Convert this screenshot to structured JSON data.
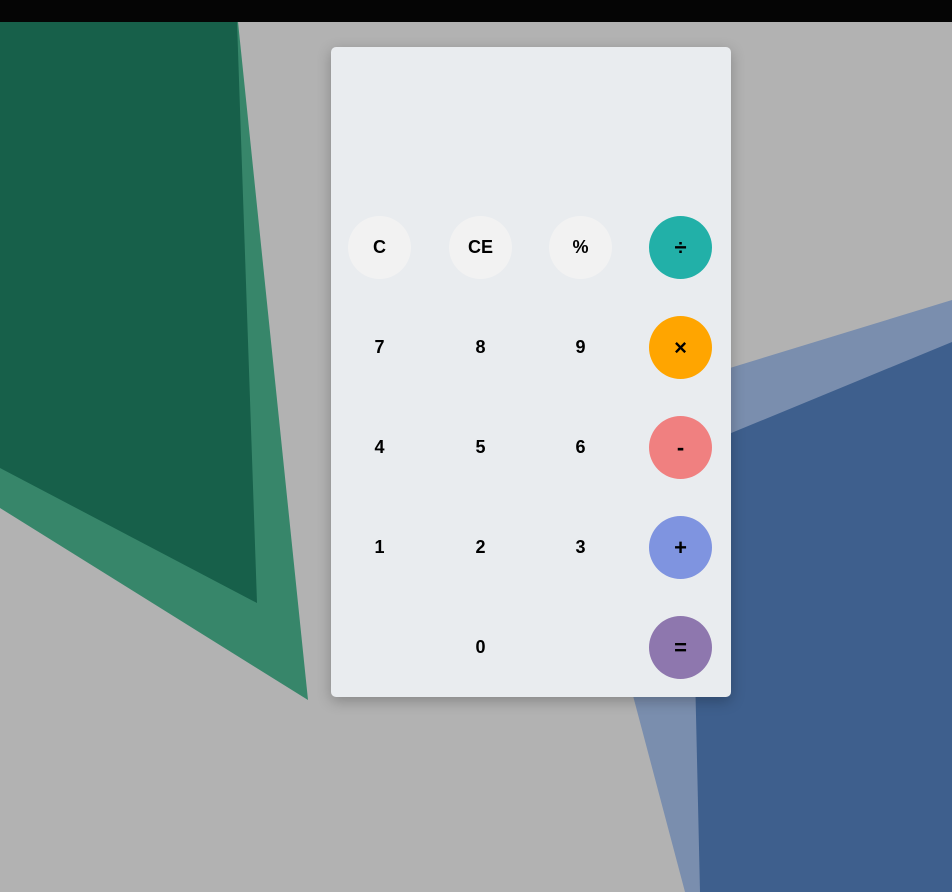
{
  "display": {
    "value": ""
  },
  "keys": {
    "clear": "C",
    "clear_entry": "CE",
    "percent": "%",
    "divide": "÷",
    "seven": "7",
    "eight": "8",
    "nine": "9",
    "multiply": "×",
    "four": "4",
    "five": "5",
    "six": "6",
    "subtract": "-",
    "one": "1",
    "two": "2",
    "three": "3",
    "add": "+",
    "zero": "0",
    "equals": "="
  },
  "colors": {
    "divide": "#22b0a8",
    "multiply": "#ffa500",
    "subtract": "#f08080",
    "add": "#7f94e0",
    "equals": "#8e77ae",
    "function_key": "#f2f2f2",
    "panel": "#e9ecef",
    "wallpaper": "#b2b2b2"
  }
}
